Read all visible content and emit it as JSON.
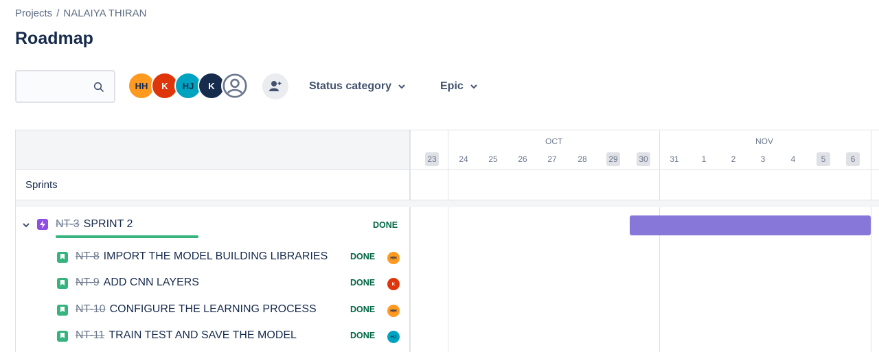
{
  "breadcrumb": {
    "projects": "Projects",
    "separator": "/",
    "project": "NALAIYA THIRAN"
  },
  "page_title": "Roadmap",
  "search": {
    "placeholder": "",
    "icon": "search-icon"
  },
  "avatars": [
    {
      "initials": "HH",
      "color": "#ff991f"
    },
    {
      "initials": "K",
      "color": "#de350b"
    },
    {
      "initials": "HJ",
      "color": "#00a3bf"
    },
    {
      "initials": "K",
      "color": "#172b4d"
    },
    {
      "initials": "",
      "color": "#6b778c"
    }
  ],
  "filters": {
    "status_category": "Status category",
    "epic": "Epic"
  },
  "timeline": {
    "months": [
      "OCT",
      "NOV"
    ],
    "days": [
      "23",
      "24",
      "25",
      "26",
      "27",
      "28",
      "29",
      "30",
      "31",
      "1",
      "2",
      "3",
      "4",
      "5",
      "6"
    ],
    "weekend_days": [
      "23",
      "29",
      "30",
      "5",
      "6"
    ]
  },
  "section": {
    "sprints": "Sprints"
  },
  "epic": {
    "key": "NT-3",
    "summary": "SPRINT 2",
    "status": "DONE",
    "progress_percent": 100,
    "bar_color": "#8777d9"
  },
  "issues": [
    {
      "key": "NT-8",
      "summary": "IMPORT THE MODEL BUILDING LIBRARIES",
      "status": "DONE",
      "assignee": "HH"
    },
    {
      "key": "NT-9",
      "summary": "ADD CNN LAYERS",
      "status": "DONE",
      "assignee": "K"
    },
    {
      "key": "NT-10",
      "summary": "CONFIGURE THE LEARNING PROCESS",
      "status": "DONE",
      "assignee": "HH"
    },
    {
      "key": "NT-11",
      "summary": "TRAIN TEST AND SAVE THE MODEL",
      "status": "DONE",
      "assignee": "HJ"
    }
  ]
}
